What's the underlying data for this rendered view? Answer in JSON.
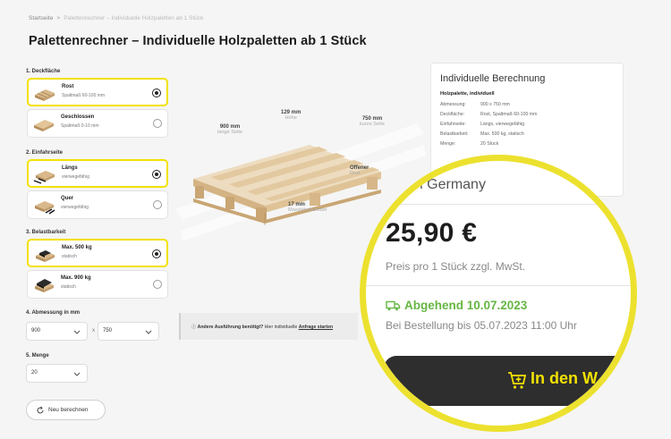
{
  "breadcrumb": {
    "home": "Startseite",
    "separator": ">",
    "current": "Palettenrechner – Individuelle Holzpaletten ab 1 Stück"
  },
  "page_title": "Palettenrechner – Individuelle Holzpaletten ab 1 Stück",
  "sections": {
    "deck": {
      "label": "1. Deckfläche",
      "options": [
        {
          "title": "Rost",
          "sub": "Spaltmaß 60-100 mm",
          "selected": true
        },
        {
          "title": "Geschlossen",
          "sub": "Spaltmaß 0-10 mm",
          "selected": false
        }
      ]
    },
    "entry": {
      "label": "2. Einfahrseite",
      "options": [
        {
          "title": "Längs",
          "sub": "vierwegefähig",
          "selected": true
        },
        {
          "title": "Quer",
          "sub": "vierwegefähig",
          "selected": false
        }
      ]
    },
    "load": {
      "label": "3. Belastbarkeit",
      "options": [
        {
          "title": "Max. 500 kg",
          "sub": "statisch",
          "selected": true
        },
        {
          "title": "Max. 900 kg",
          "sub": "statisch",
          "selected": false
        }
      ]
    },
    "dimension": {
      "label": "4. Abmessung in mm",
      "width": "900",
      "times": "x",
      "length": "750"
    },
    "quantity": {
      "label": "5. Menge",
      "value": "20"
    }
  },
  "recalc_label": "Neu berechnen",
  "notice": {
    "bold": "Andere Ausführung benötigt?",
    "text": " Hier individuelle ",
    "link": "Anfrage starten"
  },
  "pallet_labels": {
    "height": {
      "value": "129 mm",
      "label": "Höhe"
    },
    "long_side": {
      "value": "900 mm",
      "label": "lange Seite"
    },
    "short_side": {
      "value": "750 mm",
      "label": "kurze Seite"
    },
    "deck_type": {
      "value": "Offener",
      "label": "Rost"
    },
    "boards": {
      "value": "17 mm",
      "label": "Massivholzbretter"
    }
  },
  "summary": {
    "heading": "Individuelle Berechnung",
    "subheading": "Holzpalette, individuell",
    "specs": [
      {
        "key": "Abmessung:",
        "value": "900 x 750 mm"
      },
      {
        "key": "Deckfläche:",
        "value": "Rost, Spaltmaß 60-100 mm"
      },
      {
        "key": "Einfahrseite:",
        "value": "Längs, vierwegefähig"
      },
      {
        "key": "Belastbarkeit:",
        "value": "Max. 500 kg, statisch"
      },
      {
        "key": "Menge:",
        "value": "20 Stück"
      }
    ]
  },
  "magnifier": {
    "made_in": "de in Germany",
    "price": "25,90 €",
    "price_note": "Preis pro 1 Stück zzgl. MwSt.",
    "shipping": "Abgehend 10.07.2023",
    "order_note": "Bei Bestellung bis 05.07.2023 11:00 Uhr",
    "cart_button": "In den W"
  },
  "colors": {
    "accent_yellow": "#f2e100",
    "ring_yellow": "#ece12e",
    "ship_green": "#66b644",
    "button_dark": "#2e2e2e"
  }
}
